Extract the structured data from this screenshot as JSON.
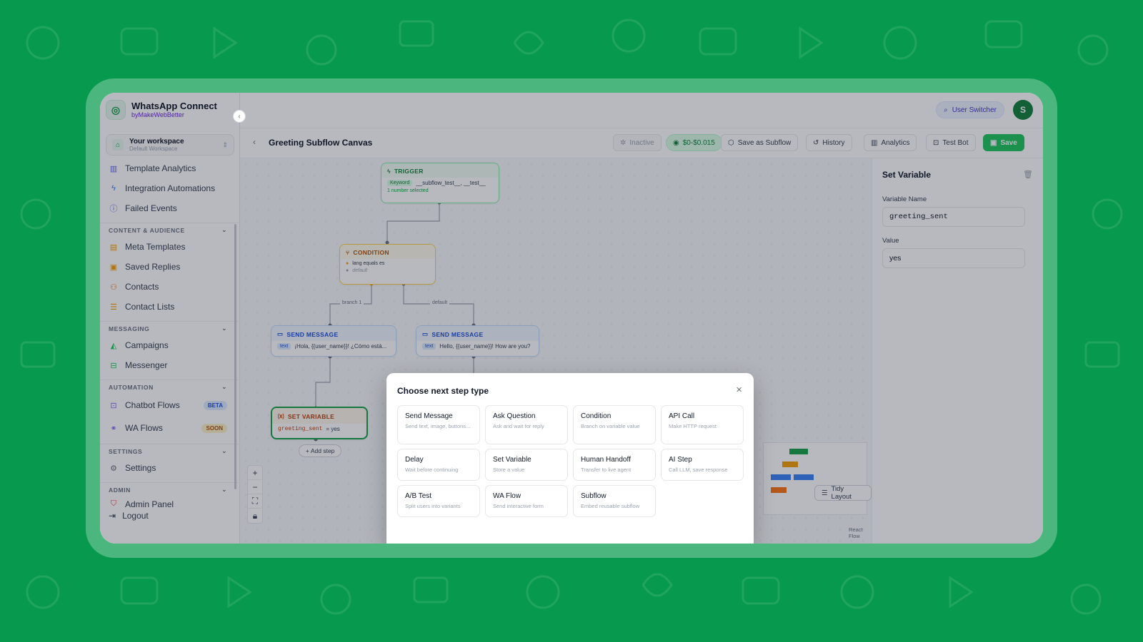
{
  "brand": {
    "name": "WhatsApp Connect",
    "by": "byMakeWebBetter"
  },
  "workspace": {
    "title": "Your workspace",
    "subtitle": "Default Workspace"
  },
  "sidebar": {
    "items_top": [
      {
        "label": "Template Analytics",
        "icon": "bar-chart-icon"
      },
      {
        "label": "Integration Automations",
        "icon": "lightning-icon"
      },
      {
        "label": "Failed Events",
        "icon": "alert-circle-icon"
      }
    ],
    "sections": [
      {
        "label": "CONTENT & AUDIENCE",
        "items": [
          {
            "label": "Meta Templates",
            "icon": "document-icon"
          },
          {
            "label": "Saved Replies",
            "icon": "bookmark-icon"
          },
          {
            "label": "Contacts",
            "icon": "users-icon"
          },
          {
            "label": "Contact Lists",
            "icon": "filter-icon"
          }
        ]
      },
      {
        "label": "MESSAGING",
        "items": [
          {
            "label": "Campaigns",
            "icon": "megaphone-icon"
          },
          {
            "label": "Messenger",
            "icon": "inbox-icon"
          }
        ]
      },
      {
        "label": "AUTOMATION",
        "items": [
          {
            "label": "Chatbot Flows",
            "icon": "bot-icon",
            "badge": "BETA"
          },
          {
            "label": "WA Flows",
            "icon": "flow-icon",
            "badge": "SOON"
          }
        ]
      },
      {
        "label": "SETTINGS",
        "items": [
          {
            "label": "Settings",
            "icon": "sliders-icon"
          }
        ]
      },
      {
        "label": "ADMIN",
        "items": [
          {
            "label": "Admin Panel",
            "icon": "shield-icon"
          }
        ]
      }
    ],
    "logout": "Logout"
  },
  "topbar": {
    "user_switcher": "User Switcher",
    "avatar": "S"
  },
  "canvas_header": {
    "title": "Greeting Subflow Canvas",
    "status": "Inactive",
    "cost": "$0-$0.015",
    "save_as_subflow": "Save as Subflow",
    "history": "History",
    "analytics": "Analytics",
    "test_bot": "Test Bot",
    "save": "Save"
  },
  "nodes": {
    "trigger": {
      "title": "TRIGGER",
      "tag": "Keyword",
      "value": "__subflow_test__, __test__",
      "note": "1 number selected"
    },
    "condition": {
      "title": "CONDITION",
      "rule": "lang equals es",
      "default": "default"
    },
    "edge_labels": {
      "branch": "branch 1",
      "default": "default"
    },
    "msg_es": {
      "title": "SEND MESSAGE",
      "tag": "text",
      "text": "¡Hola, {{user_name}}! ¿Cómo está..."
    },
    "msg_en": {
      "title": "SEND MESSAGE",
      "tag": "text",
      "text": "Hello, {{user_name}}! How are you?"
    },
    "setvar": {
      "title": "SET VARIABLE",
      "var": "greeting_sent",
      "eq": "= yes"
    }
  },
  "canvas": {
    "add_step": "+ Add step",
    "tidy_layout": "Tidy Layout",
    "react_flow": "React Flow"
  },
  "panel": {
    "title": "Set Variable",
    "var_label": "Variable Name",
    "var_value": "greeting_sent",
    "value_label": "Value",
    "value_value": "yes"
  },
  "modal": {
    "title": "Choose next step type",
    "cards": [
      {
        "title": "Send Message",
        "desc": "Send text, image, buttons..."
      },
      {
        "title": "Ask Question",
        "desc": "Ask and wait for reply"
      },
      {
        "title": "Condition",
        "desc": "Branch on variable value"
      },
      {
        "title": "API Call",
        "desc": "Make HTTP request"
      },
      {
        "title": "Delay",
        "desc": "Wait before continuing"
      },
      {
        "title": "Set Variable",
        "desc": "Store a value"
      },
      {
        "title": "Human Handoff",
        "desc": "Transfer to live agent"
      },
      {
        "title": "AI Step",
        "desc": "Call LLM, save response"
      },
      {
        "title": "A/B Test",
        "desc": "Split users into variants"
      },
      {
        "title": "WA Flow",
        "desc": "Send interactive form"
      },
      {
        "title": "Subflow",
        "desc": "Embed reusable subflow"
      }
    ]
  },
  "colors": {
    "background": "#079a4e",
    "accent": "#22c55e",
    "brand_purple": "#6d28d9"
  }
}
